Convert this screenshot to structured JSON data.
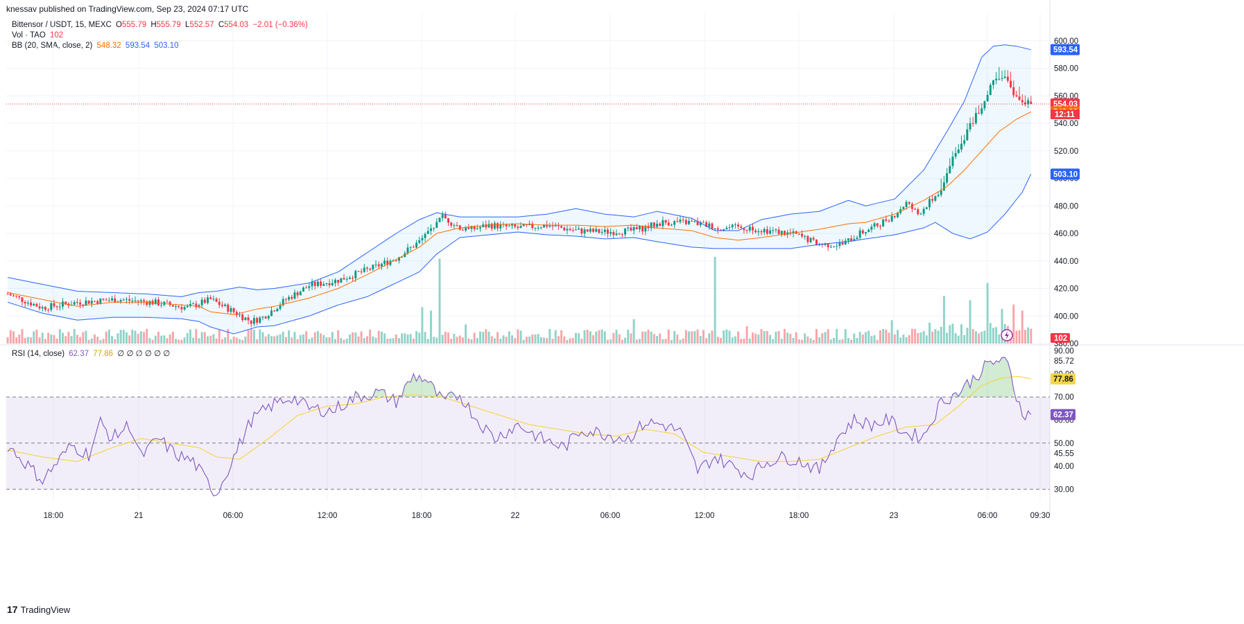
{
  "header": {
    "publish_text": "knessav published on TradingView.com, Sep 23, 2024 07:17 UTC"
  },
  "legend": {
    "symbol": "Bittensor / USDT, 15, MEXC",
    "o_label": "O",
    "o_val": "555.79",
    "h_label": "H",
    "h_val": "555.79",
    "l_label": "L",
    "l_val": "552.57",
    "c_label": "C",
    "c_val": "554.03",
    "change": "−2.01 (−0.36%)",
    "vol_label": "Vol · TAO",
    "vol_val": "102",
    "bb_label": "BB (20, SMA, close, 2)",
    "bb_basis": "548.32",
    "bb_upper": "593.54",
    "bb_lower": "503.10",
    "rsi_label": "RSI (14, close)",
    "rsi_val": "62.37",
    "rsi_ma": "77.86",
    "rsi_extra": "∅ ∅ ∅ ∅ ∅ ∅"
  },
  "footer": {
    "brand": "TradingView",
    "logo_glyph": "17"
  },
  "colors": {
    "up": "#089981",
    "down": "#f23645",
    "bb_basis": "#ff6d00",
    "bb_band": "#2962ff",
    "rsi": "#7e57c2",
    "rsi_ma": "#f5d64a",
    "vol_up": "#8fd3c8",
    "vol_down": "#f7a5a9"
  },
  "chart_data": [
    {
      "type": "candlestick",
      "title": "Bittensor / USDT, 15, MEXC",
      "ylim": [
        380,
        620
      ],
      "y_ticks": [
        "600.00",
        "580.00",
        "560.00",
        "540.00",
        "520.00",
        "500.00",
        "480.00",
        "460.00",
        "440.00",
        "420.00",
        "400.00",
        "380.00"
      ],
      "x_ticks": [
        "18:00",
        "21",
        "06:00",
        "12:00",
        "18:00",
        "22",
        "06:00",
        "12:00",
        "18:00",
        "23",
        "06:00",
        "09:30"
      ],
      "last_price": 554.03,
      "countdown": "12:11",
      "price_tags": [
        {
          "label": "593.54",
          "value": 593.54,
          "color": "#2962ff"
        },
        {
          "label": "554.03",
          "value": 554.03,
          "color": "#f23645"
        },
        {
          "label": "548.32",
          "value": 548.32,
          "color": "#ff6d00"
        },
        {
          "label": "503.10",
          "value": 503.1,
          "color": "#2962ff"
        }
      ],
      "volume_tag": "102",
      "close_anchors": [
        [
          0,
          416
        ],
        [
          12,
          406
        ],
        [
          24,
          410
        ],
        [
          38,
          412
        ],
        [
          50,
          410
        ],
        [
          62,
          406
        ],
        [
          70,
          412
        ],
        [
          78,
          403
        ],
        [
          84,
          396
        ],
        [
          88,
          399
        ],
        [
          96,
          412
        ],
        [
          104,
          422
        ],
        [
          114,
          426
        ],
        [
          126,
          435
        ],
        [
          134,
          442
        ],
        [
          142,
          454
        ],
        [
          150,
          472
        ],
        [
          158,
          462
        ],
        [
          166,
          466
        ],
        [
          176,
          464
        ],
        [
          186,
          466
        ],
        [
          196,
          462
        ],
        [
          206,
          461
        ],
        [
          216,
          462
        ],
        [
          226,
          468
        ],
        [
          236,
          468
        ],
        [
          246,
          464
        ],
        [
          256,
          464
        ],
        [
          266,
          461
        ],
        [
          272,
          459
        ],
        [
          280,
          452
        ],
        [
          288,
          452
        ],
        [
          294,
          460
        ],
        [
          300,
          466
        ],
        [
          306,
          474
        ],
        [
          310,
          482
        ],
        [
          314,
          474
        ],
        [
          322,
          492
        ],
        [
          326,
          516
        ],
        [
          330,
          530
        ],
        [
          334,
          546
        ],
        [
          337,
          556
        ],
        [
          340,
          572
        ],
        [
          343,
          575
        ],
        [
          346,
          566
        ],
        [
          348,
          558
        ],
        [
          351,
          555
        ],
        [
          353,
          554
        ]
      ],
      "bb_upper_anchors": [
        [
          0,
          428
        ],
        [
          12,
          423
        ],
        [
          24,
          418
        ],
        [
          36,
          417
        ],
        [
          48,
          416
        ],
        [
          60,
          414
        ],
        [
          66,
          417
        ],
        [
          72,
          418
        ],
        [
          80,
          421
        ],
        [
          86,
          419
        ],
        [
          92,
          420
        ],
        [
          104,
          424
        ],
        [
          114,
          432
        ],
        [
          124,
          446
        ],
        [
          134,
          460
        ],
        [
          142,
          470
        ],
        [
          148,
          475
        ],
        [
          156,
          472
        ],
        [
          166,
          472
        ],
        [
          176,
          472
        ],
        [
          186,
          474
        ],
        [
          196,
          478
        ],
        [
          206,
          474
        ],
        [
          216,
          472
        ],
        [
          224,
          476
        ],
        [
          236,
          471
        ],
        [
          244,
          462
        ],
        [
          252,
          462
        ],
        [
          260,
          470
        ],
        [
          270,
          474
        ],
        [
          280,
          476
        ],
        [
          290,
          484
        ],
        [
          296,
          480
        ],
        [
          306,
          485
        ],
        [
          316,
          506
        ],
        [
          324,
          534
        ],
        [
          330,
          556
        ],
        [
          336,
          588
        ],
        [
          340,
          596
        ],
        [
          344,
          597
        ],
        [
          348,
          596
        ],
        [
          353,
          593.5
        ]
      ],
      "bb_basis_anchors": [
        [
          0,
          417
        ],
        [
          12,
          412
        ],
        [
          24,
          407
        ],
        [
          36,
          410
        ],
        [
          48,
          410
        ],
        [
          60,
          408
        ],
        [
          66,
          407
        ],
        [
          70,
          403
        ],
        [
          78,
          401
        ],
        [
          86,
          405
        ],
        [
          92,
          407
        ],
        [
          104,
          413
        ],
        [
          114,
          420
        ],
        [
          124,
          430
        ],
        [
          134,
          441
        ],
        [
          142,
          450
        ],
        [
          148,
          460
        ],
        [
          156,
          464
        ],
        [
          166,
          466
        ],
        [
          176,
          467
        ],
        [
          186,
          466
        ],
        [
          196,
          466
        ],
        [
          206,
          465
        ],
        [
          216,
          466
        ],
        [
          224,
          464
        ],
        [
          236,
          462
        ],
        [
          244,
          457
        ],
        [
          252,
          455
        ],
        [
          260,
          457
        ],
        [
          270,
          460
        ],
        [
          280,
          463
        ],
        [
          290,
          467
        ],
        [
          296,
          468
        ],
        [
          306,
          474
        ],
        [
          316,
          484
        ],
        [
          324,
          494
        ],
        [
          330,
          506
        ],
        [
          336,
          520
        ],
        [
          342,
          534
        ],
        [
          348,
          543
        ],
        [
          353,
          548.3
        ]
      ],
      "bb_lower_anchors": [
        [
          0,
          410
        ],
        [
          12,
          402
        ],
        [
          24,
          397
        ],
        [
          36,
          399
        ],
        [
          48,
          399
        ],
        [
          60,
          398
        ],
        [
          66,
          396
        ],
        [
          70,
          392
        ],
        [
          78,
          387
        ],
        [
          86,
          392
        ],
        [
          92,
          393
        ],
        [
          104,
          400
        ],
        [
          114,
          408
        ],
        [
          124,
          414
        ],
        [
          134,
          424
        ],
        [
          142,
          432
        ],
        [
          148,
          445
        ],
        [
          156,
          457
        ],
        [
          166,
          459
        ],
        [
          176,
          461
        ],
        [
          186,
          459
        ],
        [
          196,
          458
        ],
        [
          206,
          456
        ],
        [
          216,
          457
        ],
        [
          224,
          454
        ],
        [
          236,
          450
        ],
        [
          244,
          449
        ],
        [
          252,
          449
        ],
        [
          260,
          449
        ],
        [
          270,
          449
        ],
        [
          280,
          452
        ],
        [
          290,
          454
        ],
        [
          296,
          456
        ],
        [
          306,
          459
        ],
        [
          316,
          464
        ],
        [
          320,
          468
        ],
        [
          326,
          460
        ],
        [
          332,
          456
        ],
        [
          338,
          461
        ],
        [
          344,
          474
        ],
        [
          350,
          490
        ],
        [
          353,
          503.1
        ]
      ],
      "volume_spikes": [
        [
          143,
          0.42
        ],
        [
          146,
          0.38
        ],
        [
          149,
          0.98
        ],
        [
          158,
          0.22
        ],
        [
          216,
          0.28
        ],
        [
          244,
          1.0
        ],
        [
          255,
          0.2
        ],
        [
          305,
          0.27
        ],
        [
          318,
          0.24
        ],
        [
          323,
          0.55
        ],
        [
          332,
          0.5
        ],
        [
          338,
          0.7
        ],
        [
          343,
          0.4
        ],
        [
          347,
          0.45
        ],
        [
          350,
          0.38
        ]
      ]
    },
    {
      "type": "line",
      "title": "RSI (14, close)",
      "ylim": [
        25,
        92
      ],
      "y_ticks": [
        "90.00",
        "85.72",
        "80.00",
        "70.00",
        "60.00",
        "50.00",
        "45.55",
        "40.00",
        "30.00"
      ],
      "band": [
        30,
        70
      ],
      "midline": 50,
      "rsi_anchors": [
        [
          0,
          49
        ],
        [
          8,
          39
        ],
        [
          12,
          34
        ],
        [
          16,
          40
        ],
        [
          22,
          49
        ],
        [
          28,
          45
        ],
        [
          32,
          59
        ],
        [
          36,
          52
        ],
        [
          42,
          58
        ],
        [
          46,
          44
        ],
        [
          52,
          52
        ],
        [
          58,
          45
        ],
        [
          64,
          42
        ],
        [
          70,
          31
        ],
        [
          72,
          28
        ],
        [
          78,
          44
        ],
        [
          84,
          60
        ],
        [
          92,
          67
        ],
        [
          98,
          70
        ],
        [
          104,
          65
        ],
        [
          112,
          64
        ],
        [
          120,
          70
        ],
        [
          128,
          72
        ],
        [
          134,
          68
        ],
        [
          140,
          79
        ],
        [
          144,
          78
        ],
        [
          150,
          68
        ],
        [
          156,
          71
        ],
        [
          162,
          60
        ],
        [
          168,
          52
        ],
        [
          176,
          58
        ],
        [
          184,
          52
        ],
        [
          192,
          48
        ],
        [
          198,
          56
        ],
        [
          206,
          54
        ],
        [
          214,
          52
        ],
        [
          220,
          59
        ],
        [
          226,
          58
        ],
        [
          232,
          55
        ],
        [
          238,
          38
        ],
        [
          244,
          44
        ],
        [
          250,
          40
        ],
        [
          256,
          36
        ],
        [
          262,
          42
        ],
        [
          268,
          44
        ],
        [
          274,
          42
        ],
        [
          280,
          38
        ],
        [
          286,
          52
        ],
        [
          292,
          60
        ],
        [
          298,
          58
        ],
        [
          304,
          60
        ],
        [
          310,
          54
        ],
        [
          316,
          53
        ],
        [
          322,
          68
        ],
        [
          328,
          72
        ],
        [
          334,
          79
        ],
        [
          338,
          84
        ],
        [
          342,
          86
        ],
        [
          345,
          84
        ],
        [
          348,
          70
        ],
        [
          351,
          62
        ],
        [
          353,
          62.4
        ]
      ],
      "ma_anchors": [
        [
          0,
          47
        ],
        [
          12,
          44
        ],
        [
          24,
          42
        ],
        [
          36,
          48
        ],
        [
          46,
          52
        ],
        [
          56,
          50
        ],
        [
          66,
          48
        ],
        [
          72,
          44
        ],
        [
          80,
          43
        ],
        [
          90,
          52
        ],
        [
          100,
          62
        ],
        [
          110,
          66
        ],
        [
          120,
          67
        ],
        [
          130,
          70
        ],
        [
          140,
          71
        ],
        [
          150,
          70
        ],
        [
          160,
          66
        ],
        [
          170,
          62
        ],
        [
          180,
          58
        ],
        [
          190,
          56
        ],
        [
          200,
          54
        ],
        [
          210,
          53
        ],
        [
          220,
          56
        ],
        [
          230,
          54
        ],
        [
          240,
          46
        ],
        [
          250,
          44
        ],
        [
          260,
          42
        ],
        [
          270,
          42
        ],
        [
          280,
          43
        ],
        [
          290,
          48
        ],
        [
          300,
          53
        ],
        [
          310,
          57
        ],
        [
          320,
          58
        ],
        [
          328,
          66
        ],
        [
          336,
          75
        ],
        [
          342,
          78
        ],
        [
          348,
          79
        ],
        [
          353,
          77.9
        ]
      ],
      "value_tags": [
        {
          "label": "77.86",
          "value": 77.86,
          "color": "#f5d64a"
        },
        {
          "label": "62.37",
          "value": 62.37,
          "color": "#7e57c2"
        }
      ]
    }
  ]
}
